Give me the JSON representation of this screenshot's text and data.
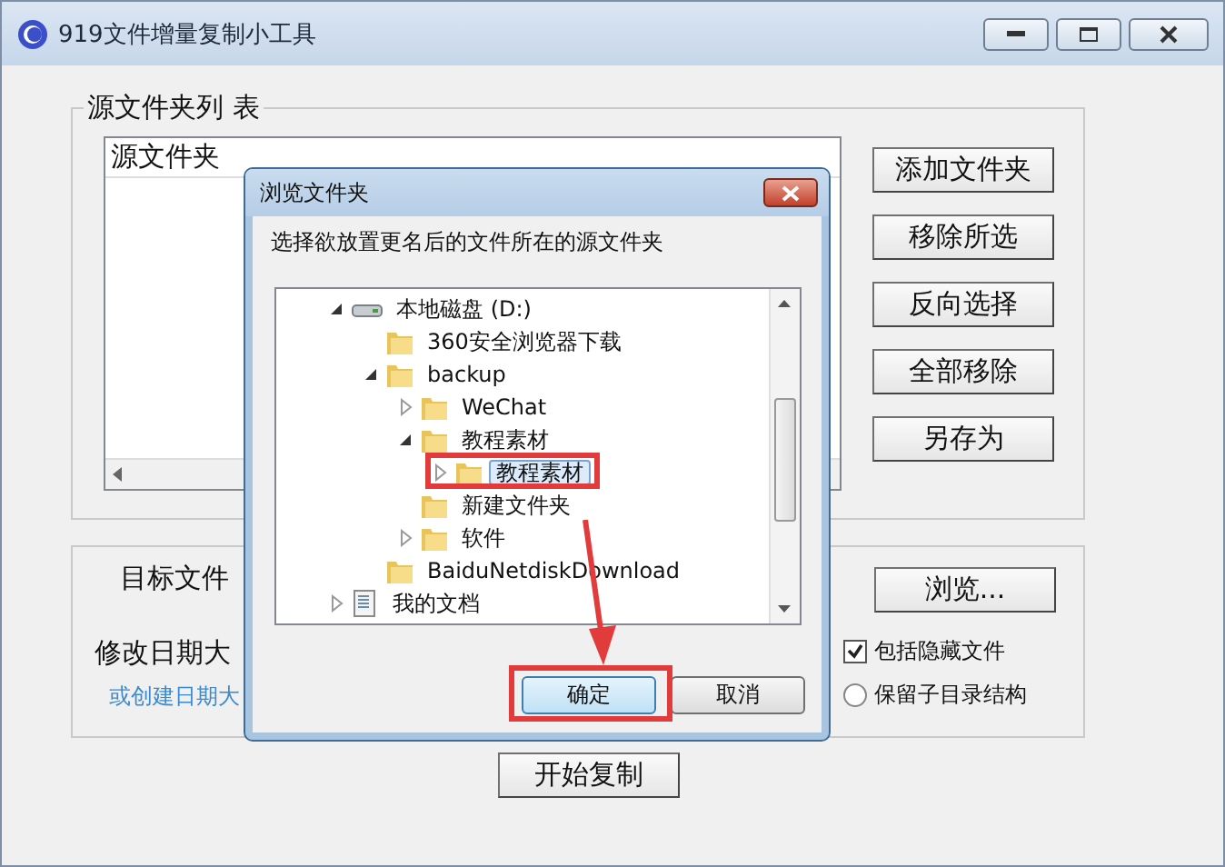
{
  "window": {
    "title": "919文件增量复制小工具"
  },
  "source_group": {
    "title": "源文件夹列 表",
    "list": {
      "header": "源文件夹"
    },
    "buttons": [
      "添加文件夹",
      "移除所选",
      "反向选择",
      "全部移除",
      "另存为"
    ]
  },
  "target_group": {
    "label": "目标文件",
    "browse_button": "浏览...",
    "date_label": "修改日期大",
    "date_hint": "或创建日期大",
    "options": [
      {
        "kind": "checkbox",
        "label": "包括隐藏文件",
        "checked": true
      },
      {
        "kind": "radio",
        "label": "保留子目录结构",
        "checked": false
      }
    ]
  },
  "start_button": "开始复制",
  "dialog": {
    "title": "浏览文件夹",
    "prompt": "选择欲放置更名后的文件所在的源文件夹",
    "tree": [
      {
        "label": "本地磁盘 (D:)",
        "kind": "drive",
        "expanded": true,
        "selected": false,
        "children": [
          {
            "label": "360安全浏览器下载",
            "kind": "folder",
            "selected": false
          },
          {
            "label": "backup",
            "kind": "folder",
            "expanded": true,
            "selected": false,
            "children": [
              {
                "label": "WeChat",
                "kind": "folder",
                "expanded": false,
                "selected": false
              },
              {
                "label": "教程素材",
                "kind": "folder",
                "expanded": true,
                "selected": false,
                "children": [
                  {
                    "label": "教程素材",
                    "kind": "folder",
                    "expanded": false,
                    "selected": true
                  }
                ]
              },
              {
                "label": "新建文件夹",
                "kind": "folder",
                "selected": false
              },
              {
                "label": "软件",
                "kind": "folder",
                "expanded": false,
                "selected": false
              }
            ]
          },
          {
            "label": "BaiduNetdiskDownload",
            "kind": "folder",
            "selected": false
          }
        ]
      },
      {
        "label": "我的文档",
        "kind": "document",
        "expanded": false,
        "selected": false
      }
    ],
    "buttons": [
      {
        "label": "确定",
        "default": true
      },
      {
        "label": "取消",
        "default": false
      }
    ]
  }
}
